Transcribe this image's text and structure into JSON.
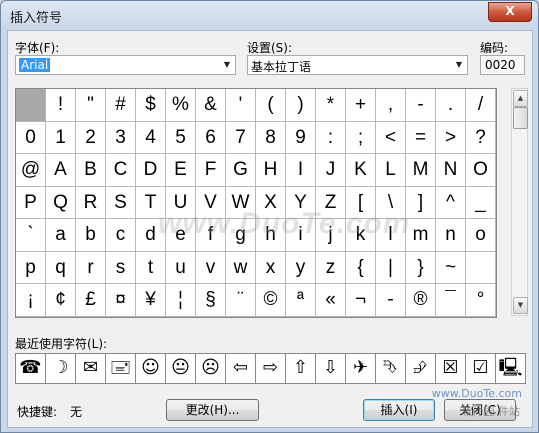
{
  "window": {
    "title": "插入符号",
    "close_glyph": "X"
  },
  "font": {
    "label": "字体(F):",
    "value": "Arial"
  },
  "subset": {
    "label": "设置(S):",
    "value": "基本拉丁语"
  },
  "code": {
    "label": "编码:",
    "value": "0020"
  },
  "symbols": [
    [
      "",
      "!",
      "\"",
      "#",
      "$",
      "%",
      "&",
      "'",
      "(",
      ")",
      "*",
      "+",
      ",",
      "-",
      ".",
      "/"
    ],
    [
      "0",
      "1",
      "2",
      "3",
      "4",
      "5",
      "6",
      "7",
      "8",
      "9",
      ":",
      ";",
      "<",
      "=",
      ">",
      "?"
    ],
    [
      "@",
      "A",
      "B",
      "C",
      "D",
      "E",
      "F",
      "G",
      "H",
      "I",
      "J",
      "K",
      "L",
      "M",
      "N",
      "O"
    ],
    [
      "P",
      "Q",
      "R",
      "S",
      "T",
      "U",
      "V",
      "W",
      "X",
      "Y",
      "Z",
      "[",
      "\\",
      "]",
      "^",
      "_"
    ],
    [
      "`",
      "a",
      "b",
      "c",
      "d",
      "e",
      "f",
      "g",
      "h",
      "i",
      "j",
      "k",
      "l",
      "m",
      "n",
      "o"
    ],
    [
      "p",
      "q",
      "r",
      "s",
      "t",
      "u",
      "v",
      "w",
      "x",
      "y",
      "z",
      "{",
      "|",
      "}",
      "~",
      ""
    ],
    [
      "¡",
      "¢",
      "£",
      "¤",
      "¥",
      "¦",
      "§",
      "¨",
      "©",
      "ª",
      "«",
      "¬",
      "-",
      "®",
      "¯",
      "°"
    ]
  ],
  "recent": {
    "label": "最近使用字符(L):",
    "items": [
      {
        "glyph": "☎",
        "icon": "telephone-icon"
      },
      {
        "glyph": "☽",
        "icon": "moon-icon"
      },
      {
        "glyph": "✉",
        "icon": "envelope-icon"
      },
      {
        "glyph": "🖃",
        "icon": "stamped-envelope-icon"
      },
      {
        "glyph": "☺",
        "icon": "smiley-icon"
      },
      {
        "glyph": "😐",
        "icon": "neutral-face-icon"
      },
      {
        "glyph": "☹",
        "icon": "frown-icon"
      },
      {
        "glyph": "⇦",
        "icon": "left-arrow-icon"
      },
      {
        "glyph": "⇨",
        "icon": "right-arrow-icon"
      },
      {
        "glyph": "⇧",
        "icon": "up-arrow-icon"
      },
      {
        "glyph": "⇩",
        "icon": "down-arrow-icon"
      },
      {
        "glyph": "✈",
        "icon": "airplane-icon"
      },
      {
        "glyph": "⮷",
        "icon": "curved-arrow-down-icon"
      },
      {
        "glyph": "⮵",
        "icon": "curved-arrow-up-icon"
      },
      {
        "glyph": "☒",
        "icon": "box-x-icon"
      },
      {
        "glyph": "☑",
        "icon": "box-check-icon"
      },
      {
        "glyph": "🖳",
        "icon": "computer-icon"
      }
    ]
  },
  "shortcut": {
    "label": "快捷键:",
    "value": "无"
  },
  "buttons": {
    "change": "更改(H)...",
    "insert": "插入(I)",
    "close": "关闭(C)"
  },
  "watermark": {
    "main": "www.DuoTe.com",
    "sub": "www.DuoTe.com",
    "corner": "软件园 件站"
  }
}
